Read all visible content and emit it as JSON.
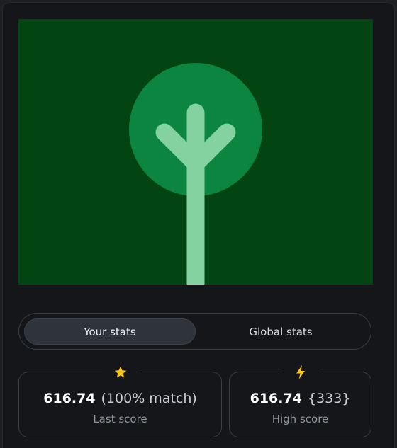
{
  "colors": {
    "panel_bg": "#141619",
    "art_bg": "#034512",
    "tree_circle": "#0b8540",
    "tree_trunk": "#83d2a0",
    "star": "#f5c518",
    "lightning": "#f5c518"
  },
  "tabs": {
    "your_stats": "Your stats",
    "global_stats": "Global stats",
    "active": "your_stats"
  },
  "stats": {
    "last": {
      "icon": "star-icon",
      "score": "616.74",
      "detail": "(100% match)",
      "label": "Last score"
    },
    "high": {
      "icon": "lightning-icon",
      "score": "616.74",
      "detail": "{333}",
      "label": "High score"
    }
  }
}
